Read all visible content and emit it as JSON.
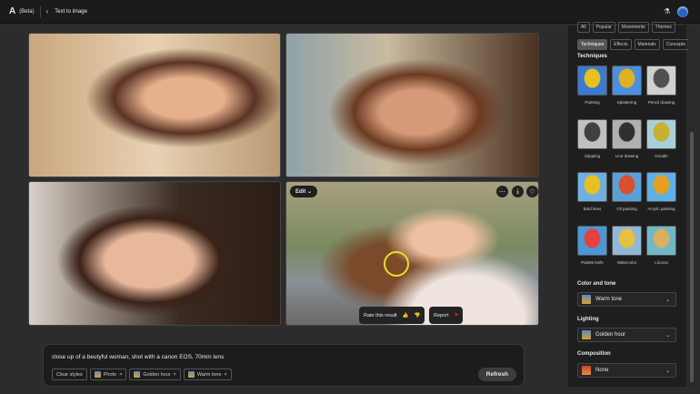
{
  "header": {
    "logo": "A",
    "beta": "(Beta)",
    "back": "‹",
    "title": "Text to image"
  },
  "image4": {
    "edit": "Edit",
    "more": "⋯",
    "download": "⤓",
    "favorite": "♡",
    "rate": "Rate this result",
    "thumbs_up": "👍",
    "thumbs_down": "👎",
    "report": "Report",
    "flag": "⚑"
  },
  "prompt": {
    "text": "close up of a beutyful woman, shot with a canon EOS, 70mm lens",
    "clear": "Clear styles",
    "chips": [
      "Photo",
      "Golden hour",
      "Warm tone"
    ],
    "refresh": "Refresh"
  },
  "panel": {
    "tabs_top": [
      "All",
      "Popular",
      "Movements",
      "Themes"
    ],
    "tabs": [
      "Techniques",
      "Effects",
      "Materials",
      "Concepts"
    ],
    "section": "Techniques",
    "techniques": [
      {
        "label": "Painting",
        "colors": [
          "#3a7ad0",
          "#e8c020"
        ]
      },
      {
        "label": "Splattering",
        "colors": [
          "#4a90e0",
          "#e0b020"
        ]
      },
      {
        "label": "Pencil drawing",
        "colors": [
          "#d0d0d0",
          "#505050"
        ]
      },
      {
        "label": "Stippling",
        "colors": [
          "#c0c0c0",
          "#404040"
        ]
      },
      {
        "label": "Line drawing",
        "colors": [
          "#b0b0b0",
          "#303030"
        ]
      },
      {
        "label": "Doodle",
        "colors": [
          "#a8d0d8",
          "#c8b030"
        ]
      },
      {
        "label": "Bold lines",
        "colors": [
          "#70b0e0",
          "#e8c020"
        ]
      },
      {
        "label": "Oil painting",
        "colors": [
          "#5aa0d8",
          "#d85030"
        ]
      },
      {
        "label": "Acrylic painting",
        "colors": [
          "#60b0e8",
          "#e8a020"
        ]
      },
      {
        "label": "Palette knife",
        "colors": [
          "#4a98d8",
          "#e84040"
        ]
      },
      {
        "label": "Watercolor",
        "colors": [
          "#90b8d8",
          "#e8c040"
        ]
      },
      {
        "label": "Linocut",
        "colors": [
          "#70b8c8",
          "#d8b060"
        ]
      }
    ],
    "color_tone": {
      "label": "Color and tone",
      "value": "Warm tone"
    },
    "lighting": {
      "label": "Lighting",
      "value": "Golden hour"
    },
    "composition": {
      "label": "Composition",
      "value": "None"
    }
  }
}
